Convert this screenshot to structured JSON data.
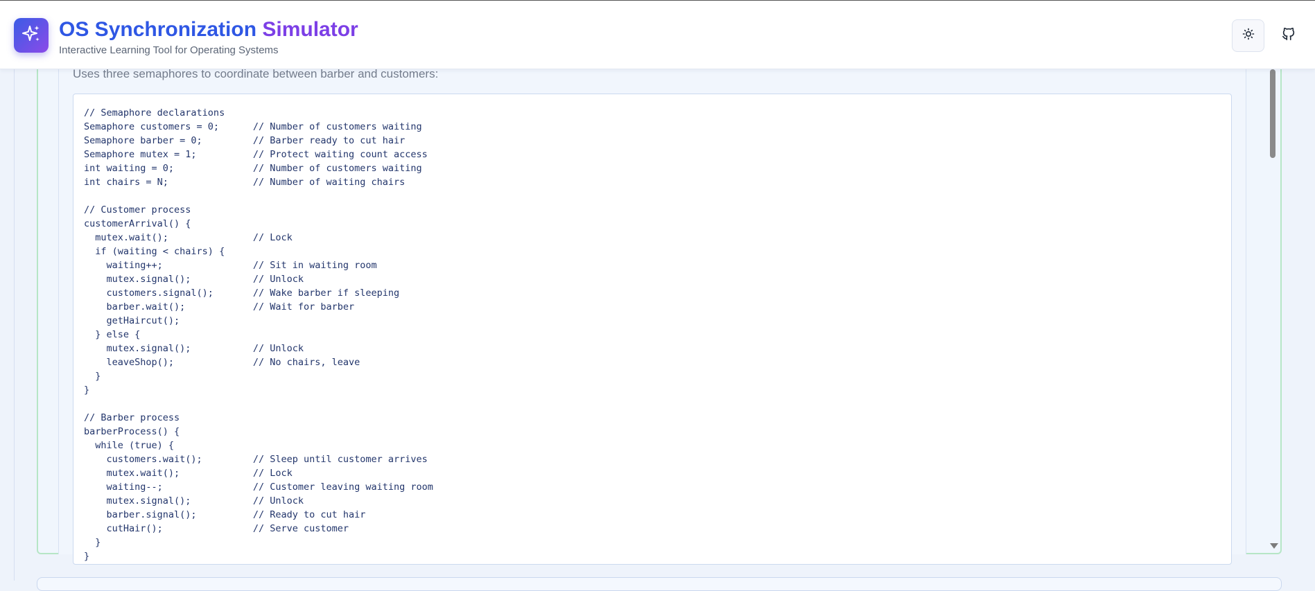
{
  "header": {
    "title_part1": "OS Synchronization",
    "title_part2": "Simulator",
    "subtitle": "Interactive Learning Tool for Operating Systems",
    "logo_icon": "sparkles-icon",
    "theme_toggle_icon": "sun-icon",
    "github_icon": "github-icon"
  },
  "section": {
    "description": "Uses three semaphores to coordinate between barber and customers:",
    "code": "// Semaphore declarations\nSemaphore customers = 0;      // Number of customers waiting\nSemaphore barber = 0;         // Barber ready to cut hair\nSemaphore mutex = 1;          // Protect waiting count access\nint waiting = 0;              // Number of customers waiting\nint chairs = N;               // Number of waiting chairs\n\n// Customer process\ncustomerArrival() {\n  mutex.wait();               // Lock\n  if (waiting < chairs) {\n    waiting++;                // Sit in waiting room\n    mutex.signal();           // Unlock\n    customers.signal();       // Wake barber if sleeping\n    barber.wait();            // Wait for barber\n    getHaircut();\n  } else {\n    mutex.signal();           // Unlock\n    leaveShop();              // No chairs, leave\n  }\n}\n\n// Barber process\nbarberProcess() {\n  while (true) {\n    customers.wait();         // Sleep until customer arrives\n    mutex.wait();             // Lock\n    waiting--;                // Customer leaving waiting room\n    mutex.signal();           // Unlock\n    barber.signal();          // Ready to cut hair\n    cutHair();                // Serve customer\n  }\n}"
  },
  "colors": {
    "title_blue": "#2f57e4",
    "title_purple": "#7c3fe6",
    "card_border_green": "#b6e6c6",
    "code_text": "#22356b",
    "page_background": "#eef3fb"
  }
}
